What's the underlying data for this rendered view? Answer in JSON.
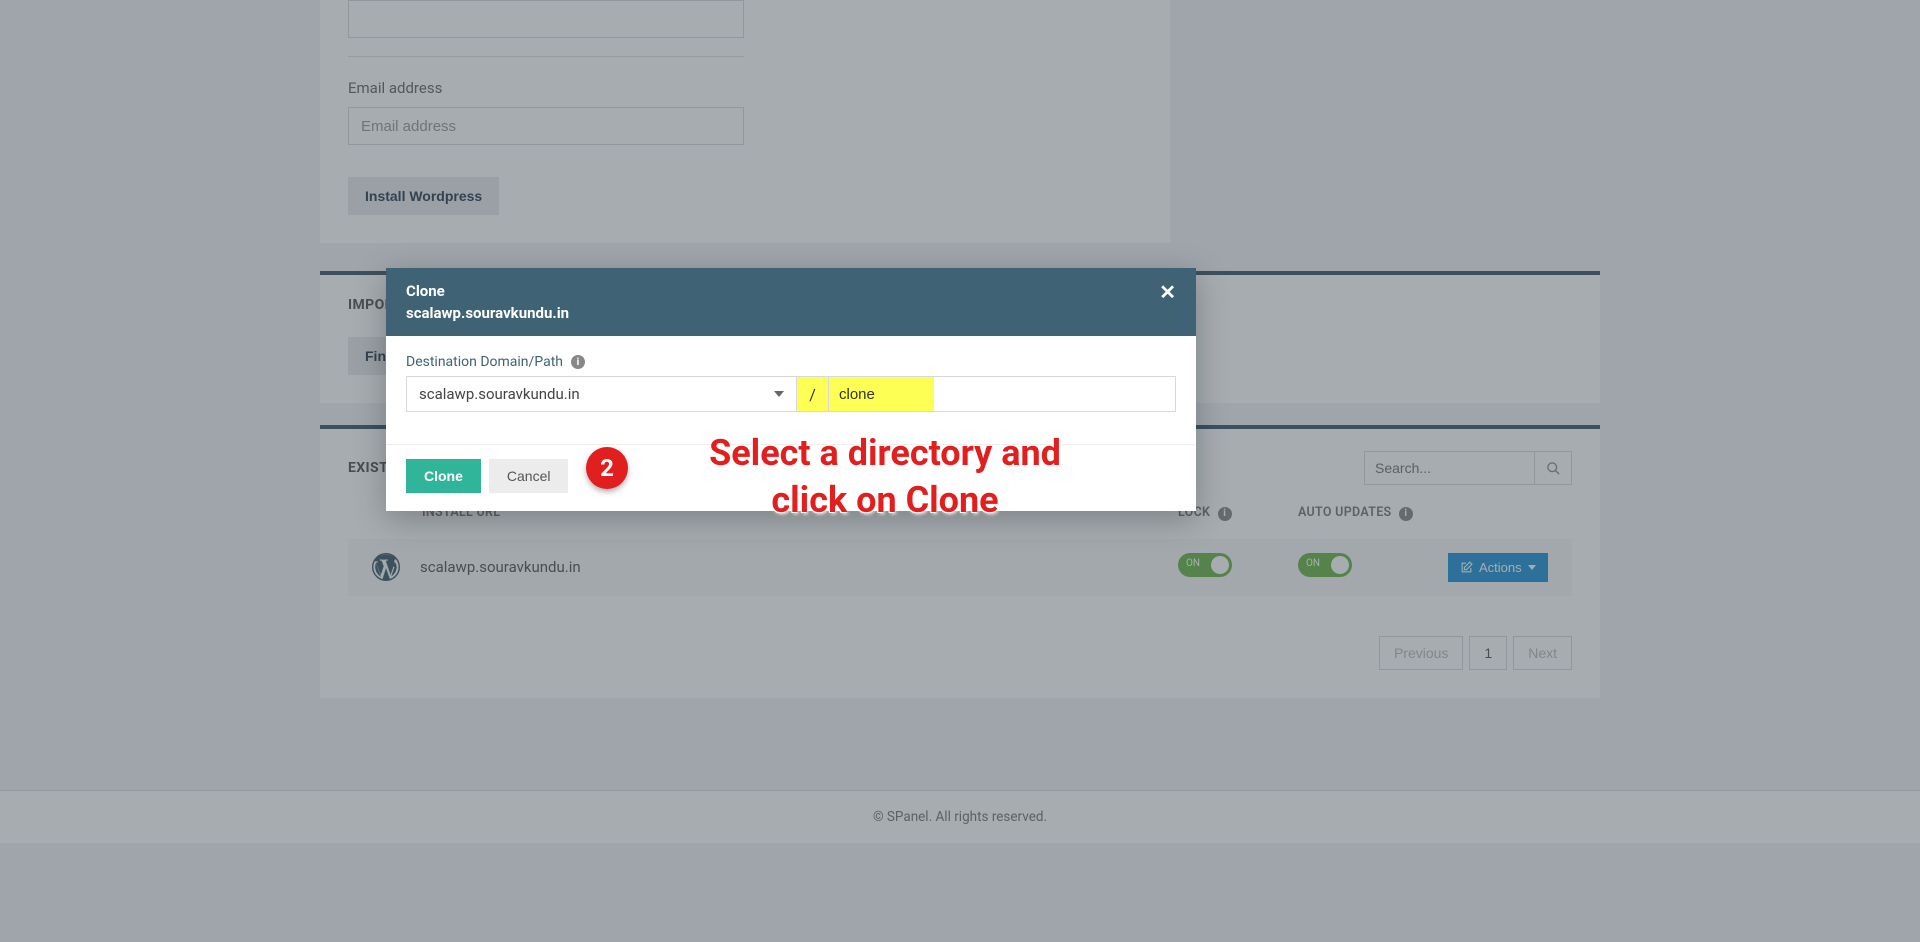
{
  "form": {
    "email_label": "Email address",
    "email_placeholder": "Email address",
    "install_btn": "Install Wordpress"
  },
  "import_panel": {
    "title": "IMPORT WORDPRESS INSTALLATION",
    "find_btn": "Find and Import"
  },
  "existing_panel": {
    "title": "EXISTING WORDPRESS INSTALLATIONS",
    "search_placeholder": "Search...",
    "headers": {
      "url": "INSTALL URL",
      "lock": "LOCK",
      "auto": "AUTO UPDATES"
    },
    "rows": [
      {
        "url": "scalawp.souravkundu.in",
        "lock": "ON",
        "auto": "ON"
      }
    ],
    "actions_btn": "Actions"
  },
  "pagination": {
    "prev": "Previous",
    "page": "1",
    "next": "Next"
  },
  "footer": "© SPanel. All rights reserved.",
  "modal": {
    "title": "Clone",
    "subtitle": "scalawp.souravkundu.in",
    "dest_label": "Destination Domain/Path",
    "domain": "scalawp.souravkundu.in",
    "slash": "/",
    "path_value": "clone",
    "clone_btn": "Clone",
    "cancel_btn": "Cancel"
  },
  "annotations": {
    "step2": "2",
    "text1": "Select a directory and click on Clone"
  }
}
